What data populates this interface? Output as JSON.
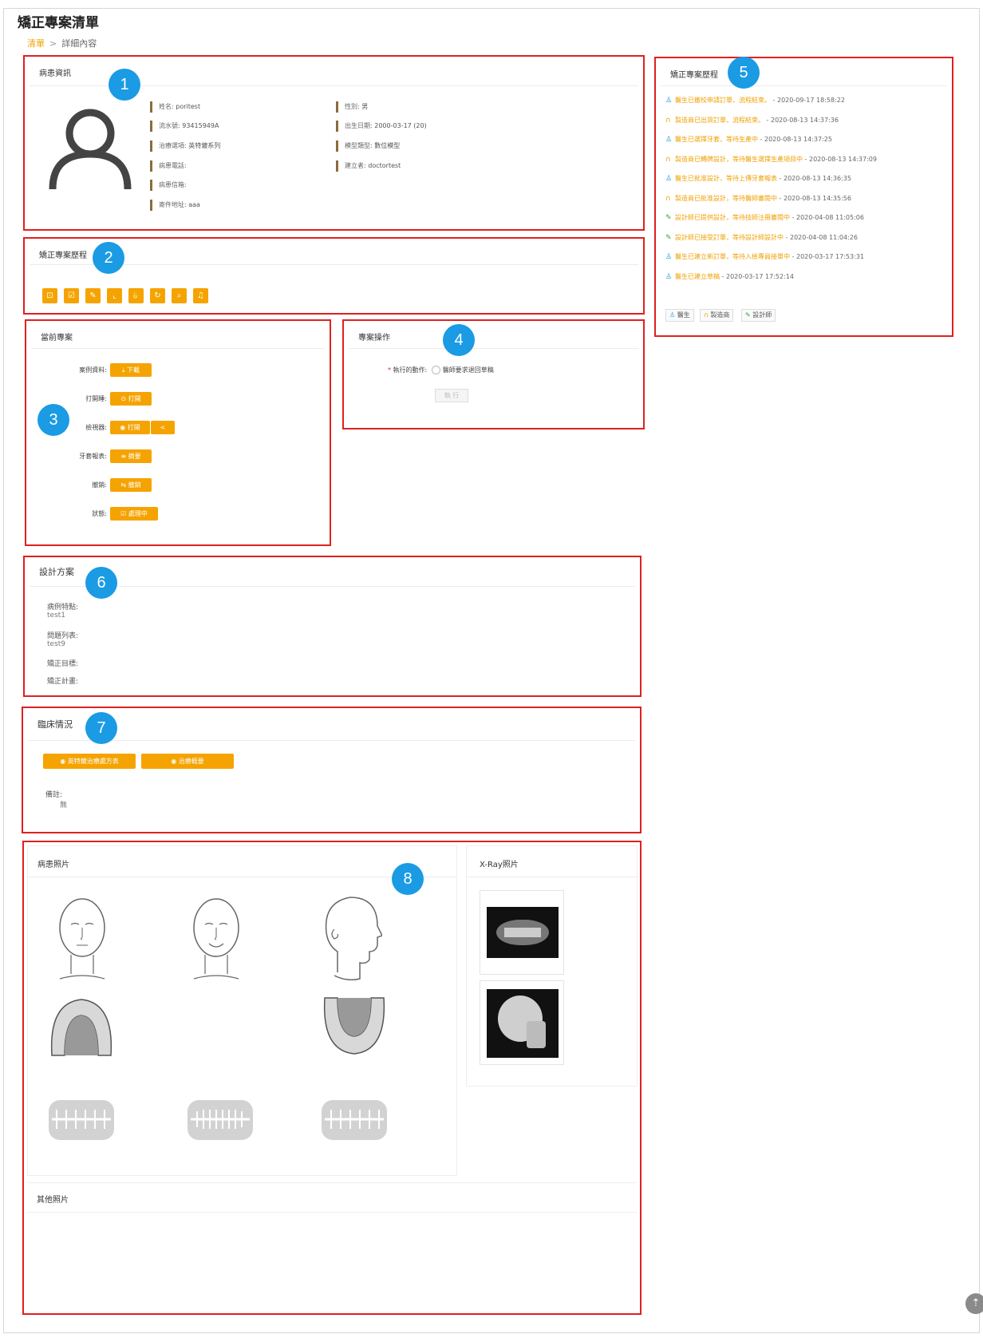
{
  "page": {
    "title": "矯正專案清單",
    "breadcrumb": {
      "list": "清單",
      "separator": ">",
      "current": "詳細內容"
    }
  },
  "annotations": [
    "1",
    "2",
    "3",
    "4",
    "5",
    "6",
    "7",
    "8"
  ],
  "patient_info": {
    "title": "病患資訊",
    "avatar_icon": "user-icon",
    "left_fields": [
      {
        "label": "姓名:",
        "value": "poritest"
      },
      {
        "label": "流水號:",
        "value": "93415949A"
      },
      {
        "label": "治療選項:",
        "value": "英特鍍系列"
      },
      {
        "label": "病患電話:",
        "value": ""
      },
      {
        "label": "病患信箱:",
        "value": ""
      },
      {
        "label": "寄件地址:",
        "value": "aaa"
      }
    ],
    "right_fields": [
      {
        "label": "性別:",
        "value": "男"
      },
      {
        "label": "出生日期:",
        "value": "2000-03-17 (20)"
      },
      {
        "label": "模型類型:",
        "value": "數位模型"
      },
      {
        "label": "建立者:",
        "value": "doctortest"
      }
    ]
  },
  "process_steps": {
    "title": "矯正專案歷程",
    "step_icons": [
      "cart-icon",
      "check-square-icon",
      "edit-icon",
      "chart-icon",
      "thumb-up-icon",
      "sync-icon",
      "search-icon",
      "bell-icon"
    ]
  },
  "current_project": {
    "title": "當前專案",
    "fields": [
      {
        "label": "案例資料:",
        "button": "⤓ 下載"
      },
      {
        "label": "打開睡:",
        "button": "⊙ 打開"
      },
      {
        "label": "檢視器:",
        "button": "◉ 打開",
        "extra": "<"
      },
      {
        "label": "牙套報表:",
        "button": "≡ 摘要"
      },
      {
        "label": "撤銷:",
        "button": "⇆ 撤銷"
      },
      {
        "label": "狀態:",
        "button": "☑ 處理中"
      }
    ]
  },
  "project_ops": {
    "title": "專案操作",
    "action_label": "執行的動作:",
    "required_mark": "*",
    "radio_option": "醫師要求退回草稿",
    "execute_button": "執 行"
  },
  "history": {
    "title": "矯正專案歷程",
    "items": [
      {
        "icon": "doctor-icon",
        "msg": "醫生已撤校申請訂單，流程結束。",
        "time": " - 2020-09-17 18:58:22",
        "color": "#1a9be4",
        "highlight": true
      },
      {
        "icon": "headset-icon",
        "msg": "製造商已出貨訂單，流程結束。",
        "time": " - 2020-08-13 14:37:36",
        "color": "#f0a000",
        "highlight": true
      },
      {
        "icon": "doctor-icon",
        "msg": "醫生已選擇牙套，等待生產中",
        "time": " - 2020-08-13 14:37:25",
        "color": "#1a9be4",
        "highlight": true
      },
      {
        "icon": "headset-icon",
        "msg": "製造商已轉牌設計，等待醫生選擇生產項目中",
        "time": " - 2020-08-13 14:37:09",
        "color": "#f0a000",
        "highlight": true
      },
      {
        "icon": "doctor-icon",
        "msg": "醫生已批准設計，等待上傳牙套報表",
        "time": " - 2020-08-13 14:36:35",
        "color": "#1a9be4",
        "highlight": true
      },
      {
        "icon": "headset-icon",
        "msg": "製造商已批准設計，等待醫師審閱中",
        "time": " - 2020-08-13 14:35:56",
        "color": "#f0a000",
        "highlight": true
      },
      {
        "icon": "pen-icon",
        "msg": "設計師已提供設計，等待技師注冊審閱中",
        "time": " - 2020-04-08 11:05:06",
        "color": "#2ea84a",
        "highlight": true
      },
      {
        "icon": "pen-icon",
        "msg": "設計師已接受訂單，等待設計師設計中",
        "time": " - 2020-04-08 11:04:26",
        "color": "#2ea84a",
        "highlight": true
      },
      {
        "icon": "doctor-icon",
        "msg": "醫生已建立新訂單，等待入檢專員接單中",
        "time": " - 2020-03-17 17:53:31",
        "color": "#1a9be4",
        "highlight": true
      },
      {
        "icon": "doctor-icon",
        "msg": "醫生已建立草稿",
        "time": " - 2020-03-17 17:52:14",
        "color": "#1a9be4",
        "highlight": true
      }
    ],
    "legend": [
      {
        "icon": "doctor-icon",
        "label": "醫生",
        "color": "#1a9be4"
      },
      {
        "icon": "headset-icon",
        "label": "製造商",
        "color": "#f0a000"
      },
      {
        "icon": "pen-icon",
        "label": "設計師",
        "color": "#2ea84a"
      }
    ]
  },
  "design_plan": {
    "title": "設計方案",
    "fields": [
      {
        "label": "病例特點:",
        "value": "test1"
      },
      {
        "label": "問題列表:",
        "value": "test9"
      },
      {
        "label": "矯正目標:",
        "value": ""
      },
      {
        "label": "矯正計畫:",
        "value": ""
      }
    ]
  },
  "clinical": {
    "title": "臨床情況",
    "buttons": [
      "◉ 英特鍍治療處方表",
      "◉ 治療概要"
    ],
    "note_label": "備註:",
    "note_value": "無"
  },
  "photos": {
    "patient_title": "病患照片",
    "xray_title": "X-Ray照片",
    "other_title": "其他照片"
  },
  "fab_icon": "arrow-up-icon"
}
